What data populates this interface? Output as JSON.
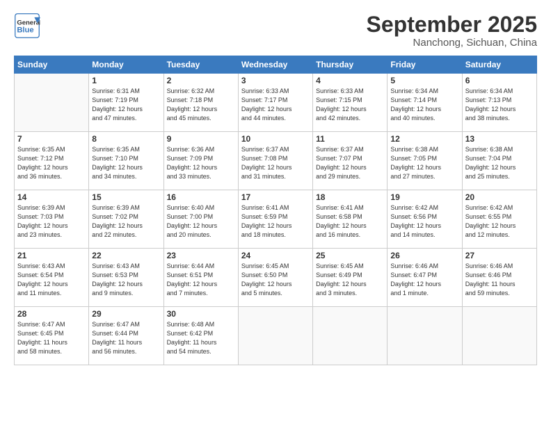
{
  "header": {
    "logo_line1": "General",
    "logo_line2": "Blue",
    "month_title": "September 2025",
    "location": "Nanchong, Sichuan, China"
  },
  "days_of_week": [
    "Sunday",
    "Monday",
    "Tuesday",
    "Wednesday",
    "Thursday",
    "Friday",
    "Saturday"
  ],
  "weeks": [
    [
      {
        "day": "",
        "info": ""
      },
      {
        "day": "1",
        "info": "Sunrise: 6:31 AM\nSunset: 7:19 PM\nDaylight: 12 hours\nand 47 minutes."
      },
      {
        "day": "2",
        "info": "Sunrise: 6:32 AM\nSunset: 7:18 PM\nDaylight: 12 hours\nand 45 minutes."
      },
      {
        "day": "3",
        "info": "Sunrise: 6:33 AM\nSunset: 7:17 PM\nDaylight: 12 hours\nand 44 minutes."
      },
      {
        "day": "4",
        "info": "Sunrise: 6:33 AM\nSunset: 7:15 PM\nDaylight: 12 hours\nand 42 minutes."
      },
      {
        "day": "5",
        "info": "Sunrise: 6:34 AM\nSunset: 7:14 PM\nDaylight: 12 hours\nand 40 minutes."
      },
      {
        "day": "6",
        "info": "Sunrise: 6:34 AM\nSunset: 7:13 PM\nDaylight: 12 hours\nand 38 minutes."
      }
    ],
    [
      {
        "day": "7",
        "info": "Sunrise: 6:35 AM\nSunset: 7:12 PM\nDaylight: 12 hours\nand 36 minutes."
      },
      {
        "day": "8",
        "info": "Sunrise: 6:35 AM\nSunset: 7:10 PM\nDaylight: 12 hours\nand 34 minutes."
      },
      {
        "day": "9",
        "info": "Sunrise: 6:36 AM\nSunset: 7:09 PM\nDaylight: 12 hours\nand 33 minutes."
      },
      {
        "day": "10",
        "info": "Sunrise: 6:37 AM\nSunset: 7:08 PM\nDaylight: 12 hours\nand 31 minutes."
      },
      {
        "day": "11",
        "info": "Sunrise: 6:37 AM\nSunset: 7:07 PM\nDaylight: 12 hours\nand 29 minutes."
      },
      {
        "day": "12",
        "info": "Sunrise: 6:38 AM\nSunset: 7:05 PM\nDaylight: 12 hours\nand 27 minutes."
      },
      {
        "day": "13",
        "info": "Sunrise: 6:38 AM\nSunset: 7:04 PM\nDaylight: 12 hours\nand 25 minutes."
      }
    ],
    [
      {
        "day": "14",
        "info": "Sunrise: 6:39 AM\nSunset: 7:03 PM\nDaylight: 12 hours\nand 23 minutes."
      },
      {
        "day": "15",
        "info": "Sunrise: 6:39 AM\nSunset: 7:02 PM\nDaylight: 12 hours\nand 22 minutes."
      },
      {
        "day": "16",
        "info": "Sunrise: 6:40 AM\nSunset: 7:00 PM\nDaylight: 12 hours\nand 20 minutes."
      },
      {
        "day": "17",
        "info": "Sunrise: 6:41 AM\nSunset: 6:59 PM\nDaylight: 12 hours\nand 18 minutes."
      },
      {
        "day": "18",
        "info": "Sunrise: 6:41 AM\nSunset: 6:58 PM\nDaylight: 12 hours\nand 16 minutes."
      },
      {
        "day": "19",
        "info": "Sunrise: 6:42 AM\nSunset: 6:56 PM\nDaylight: 12 hours\nand 14 minutes."
      },
      {
        "day": "20",
        "info": "Sunrise: 6:42 AM\nSunset: 6:55 PM\nDaylight: 12 hours\nand 12 minutes."
      }
    ],
    [
      {
        "day": "21",
        "info": "Sunrise: 6:43 AM\nSunset: 6:54 PM\nDaylight: 12 hours\nand 11 minutes."
      },
      {
        "day": "22",
        "info": "Sunrise: 6:43 AM\nSunset: 6:53 PM\nDaylight: 12 hours\nand 9 minutes."
      },
      {
        "day": "23",
        "info": "Sunrise: 6:44 AM\nSunset: 6:51 PM\nDaylight: 12 hours\nand 7 minutes."
      },
      {
        "day": "24",
        "info": "Sunrise: 6:45 AM\nSunset: 6:50 PM\nDaylight: 12 hours\nand 5 minutes."
      },
      {
        "day": "25",
        "info": "Sunrise: 6:45 AM\nSunset: 6:49 PM\nDaylight: 12 hours\nand 3 minutes."
      },
      {
        "day": "26",
        "info": "Sunrise: 6:46 AM\nSunset: 6:47 PM\nDaylight: 12 hours\nand 1 minute."
      },
      {
        "day": "27",
        "info": "Sunrise: 6:46 AM\nSunset: 6:46 PM\nDaylight: 11 hours\nand 59 minutes."
      }
    ],
    [
      {
        "day": "28",
        "info": "Sunrise: 6:47 AM\nSunset: 6:45 PM\nDaylight: 11 hours\nand 58 minutes."
      },
      {
        "day": "29",
        "info": "Sunrise: 6:47 AM\nSunset: 6:44 PM\nDaylight: 11 hours\nand 56 minutes."
      },
      {
        "day": "30",
        "info": "Sunrise: 6:48 AM\nSunset: 6:42 PM\nDaylight: 11 hours\nand 54 minutes."
      },
      {
        "day": "",
        "info": ""
      },
      {
        "day": "",
        "info": ""
      },
      {
        "day": "",
        "info": ""
      },
      {
        "day": "",
        "info": ""
      }
    ]
  ]
}
